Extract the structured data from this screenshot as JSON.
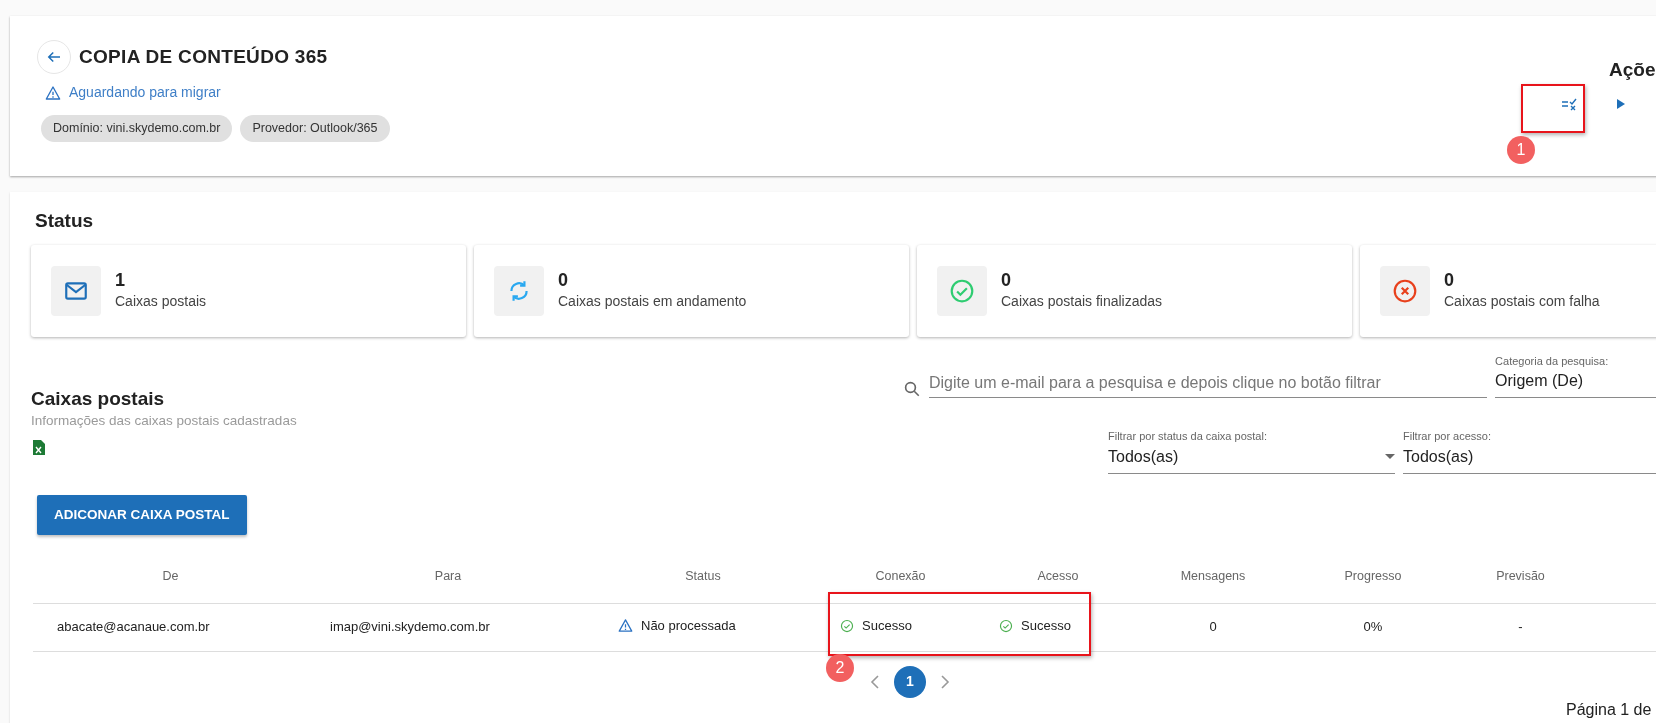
{
  "header": {
    "title": "COPIA DE CONTEÚDO 365",
    "status": {
      "text": "Aguardando para migrar",
      "kind": "warning"
    },
    "chips": [
      "Domínio: vini.skydemo.com.br",
      "Provedor: Outlook/365"
    ],
    "actions_title": "Açõe"
  },
  "status_section": {
    "title": "Status",
    "cards": [
      {
        "count": "1",
        "label": "Caixas postais",
        "kind": "mail"
      },
      {
        "count": "0",
        "label": "Caixas postais em andamento",
        "kind": "sync"
      },
      {
        "count": "0",
        "label": "Caixas postais finalizadas",
        "kind": "done"
      },
      {
        "count": "0",
        "label": "Caixas postais com falha",
        "kind": "failed"
      }
    ]
  },
  "mailboxes": {
    "title": "Caixas postais",
    "subtitle": "Informações das caixas postais cadastradas",
    "search": {
      "placeholder": "Digite um e-mail para a pesquisa e depois clique no botão filtrar"
    },
    "category": {
      "label": "Categoria da pesquisa:",
      "value": "Origem (De)"
    },
    "filters": [
      {
        "label": "Filtrar por status da caixa postal:",
        "value": "Todos(as)"
      },
      {
        "label": "Filtrar por acesso:",
        "value": "Todos(as)"
      }
    ],
    "add_button": "ADICONAR CAIXA POSTAL",
    "table": {
      "columns": [
        "De",
        "Para",
        "Status",
        "Conexão",
        "Acesso",
        "Mensagens",
        "Progresso",
        "Previsão"
      ],
      "rows": [
        [
          {
            "text": "abacate@acanaue.com.br",
            "kind": "plain"
          },
          {
            "text": "imap@vini.skydemo.com.br",
            "kind": "plain"
          },
          {
            "text": "Não processada",
            "kind": "warning"
          },
          {
            "text": "Sucesso",
            "kind": "success"
          },
          {
            "text": "Sucesso",
            "kind": "success"
          },
          {
            "text": "0",
            "kind": "plain"
          },
          {
            "text": "0%",
            "kind": "plain"
          },
          {
            "text": "-",
            "kind": "plain"
          }
        ]
      ]
    },
    "pagination": {
      "pages": [
        {
          "label": "1",
          "selected": true
        }
      ],
      "info": "Página 1 de"
    }
  },
  "annotations": [
    {
      "number": "1"
    },
    {
      "number": "2"
    }
  ]
}
